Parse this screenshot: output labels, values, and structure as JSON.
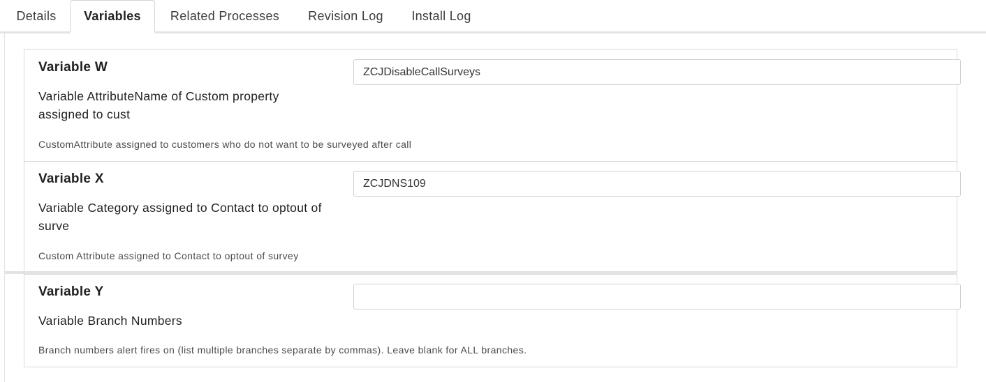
{
  "tabs": {
    "details": "Details",
    "variables": "Variables",
    "related": "Related Processes",
    "revision": "Revision Log",
    "install": "Install Log"
  },
  "variables": [
    {
      "title": "Variable W",
      "name": "Variable AttributeName of Custom property assigned to cust",
      "value": "ZCJDisableCallSurveys",
      "description": "CustomAttribute assigned to customers who do not want to be surveyed after call"
    },
    {
      "title": "Variable X",
      "name": "Variable Category assigned to Contact to optout of surve",
      "value": "ZCJDNS109",
      "description": "Custom Attribute assigned to Contact to optout of survey"
    },
    {
      "title": "Variable Y",
      "name": "Variable Branch Numbers",
      "value": "",
      "description": "Branch numbers alert fires on (list multiple branches separate by commas). Leave blank for ALL branches."
    }
  ]
}
